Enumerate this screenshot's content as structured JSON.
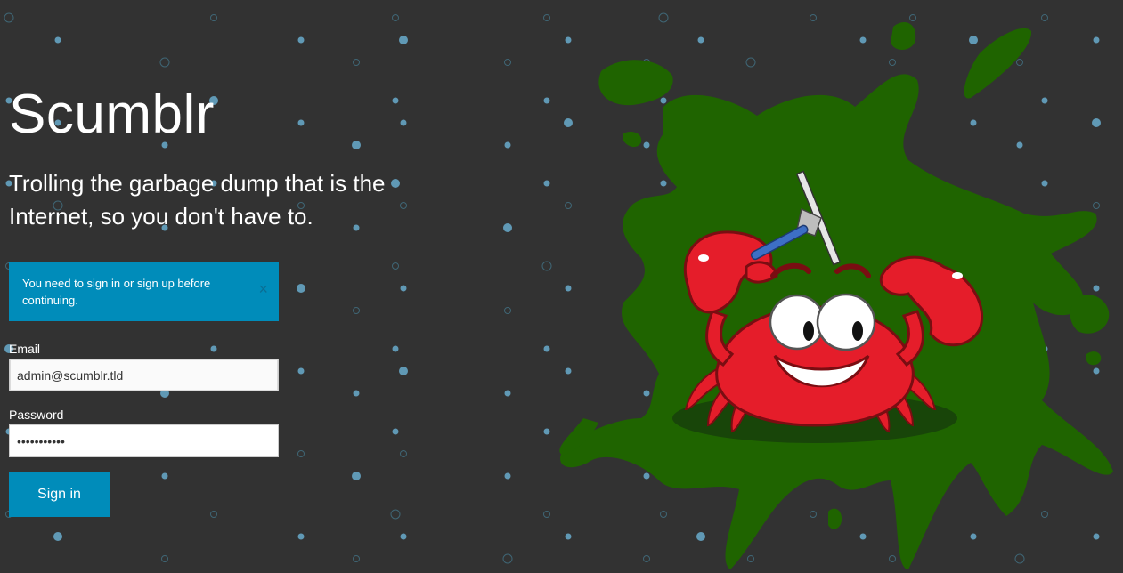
{
  "brand": {
    "title": "Scumblr",
    "tagline": "Trolling the garbage dump that is the Internet, so you don't have to."
  },
  "alert": {
    "message": "You need to sign in or sign up before continuing.",
    "close_glyph": "×"
  },
  "form": {
    "email_label": "Email",
    "email_value": "admin@scumblr.tld",
    "password_label": "Password",
    "password_value": "scumblrpass",
    "submit_label": "Sign in"
  },
  "colors": {
    "background": "#323232",
    "accent": "#008cba",
    "slime": "#1f6400",
    "crab_red": "#e51d2a",
    "bubble": "#6bb3d6"
  },
  "icons": {
    "close": "close-icon",
    "mascot": "crab-mascot-illustration"
  }
}
